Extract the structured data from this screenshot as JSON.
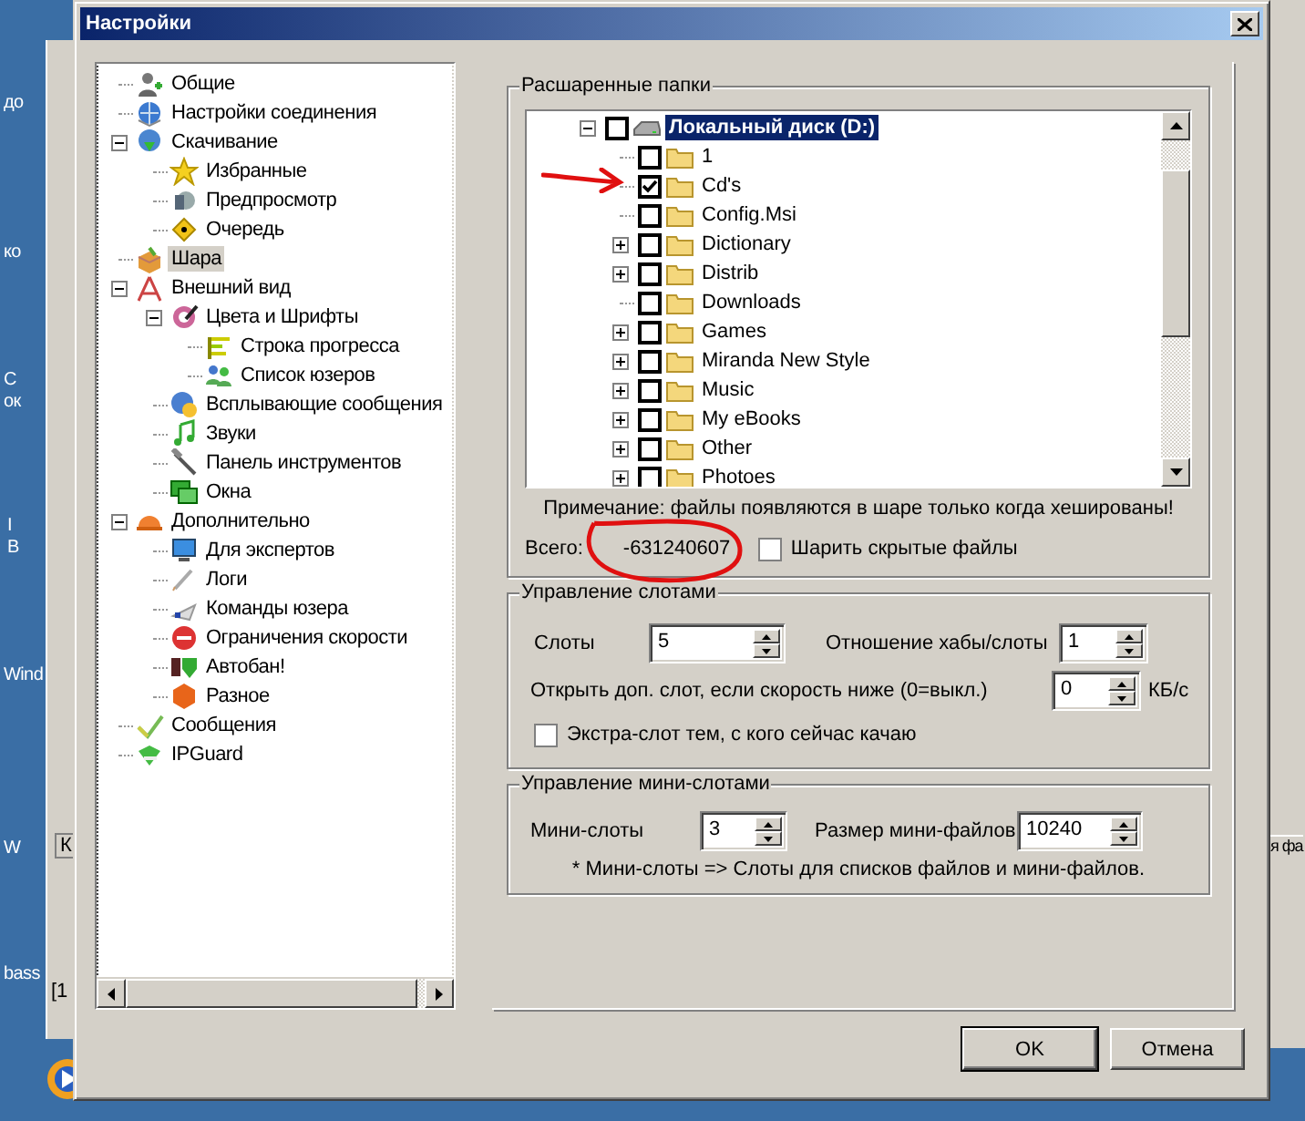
{
  "desktop": {
    "labels": [
      "до",
      "ко",
      "С",
      "ок",
      "I",
      "B",
      "Wind",
      "W",
      "bass"
    ]
  },
  "background_windows": {
    "left_texts": [
      "К",
      "[1"
    ],
    "right_text": "я фа"
  },
  "window": {
    "title": "Настройки"
  },
  "nav_tree": [
    {
      "label": "Общие",
      "selected": false
    },
    {
      "label": "Настройки соединения",
      "selected": false
    },
    {
      "label": "Скачивание",
      "selected": false,
      "expanded": true,
      "children": [
        {
          "label": "Избранные",
          "selected": false
        },
        {
          "label": "Предпросмотр",
          "selected": false
        },
        {
          "label": "Очередь",
          "selected": false
        }
      ]
    },
    {
      "label": "Шара",
      "selected": true
    },
    {
      "label": "Внешний вид",
      "selected": false,
      "expanded": true,
      "children": [
        {
          "label": "Цвета и Шрифты",
          "selected": false,
          "expanded": true,
          "children": [
            {
              "label": "Строка прогресса",
              "selected": false
            },
            {
              "label": "Список юзеров",
              "selected": false
            }
          ]
        },
        {
          "label": "Всплывающие сообщения",
          "selected": false
        },
        {
          "label": "Звуки",
          "selected": false
        },
        {
          "label": "Панель инструментов",
          "selected": false
        },
        {
          "label": "Окна",
          "selected": false
        }
      ]
    },
    {
      "label": "Дополнительно",
      "selected": false,
      "expanded": true,
      "children": [
        {
          "label": "Для экспертов",
          "selected": false
        },
        {
          "label": "Логи",
          "selected": false
        },
        {
          "label": "Команды юзера",
          "selected": false
        },
        {
          "label": "Ограничения скорости",
          "selected": false
        },
        {
          "label": "Автобан!",
          "selected": false
        },
        {
          "label": "Разное",
          "selected": false
        }
      ]
    },
    {
      "label": "Сообщения",
      "selected": false
    },
    {
      "label": "IPGuard",
      "selected": false
    }
  ],
  "shared_folders": {
    "title": "Расшаренные папки",
    "root": {
      "label": "Локальный диск (D:)",
      "checked": false,
      "selected": true,
      "expanded": true
    },
    "folders": [
      {
        "label": "1",
        "checked": false,
        "expandable": false
      },
      {
        "label": "Cd's",
        "checked": true,
        "expandable": false
      },
      {
        "label": "Config.Msi",
        "checked": false,
        "expandable": false
      },
      {
        "label": "Dictionary",
        "checked": false,
        "expandable": true
      },
      {
        "label": "Distrib",
        "checked": false,
        "expandable": true
      },
      {
        "label": "Downloads",
        "checked": false,
        "expandable": false
      },
      {
        "label": "Games",
        "checked": false,
        "expandable": true
      },
      {
        "label": "Miranda New Style",
        "checked": false,
        "expandable": true
      },
      {
        "label": "Music",
        "checked": false,
        "expandable": true
      },
      {
        "label": "My eBooks",
        "checked": false,
        "expandable": true
      },
      {
        "label": "Other",
        "checked": false,
        "expandable": true
      },
      {
        "label": "Photoes",
        "checked": false,
        "expandable": true
      }
    ],
    "note": "Примечание: файлы появляются в шаре только когда хешированы!",
    "total_label": "Всего:",
    "total_value": "-631240607",
    "share_hidden": {
      "label": "Шарить скрытые файлы",
      "checked": false
    }
  },
  "slots": {
    "title": "Управление слотами",
    "slots": {
      "label": "Слоты",
      "value": "5"
    },
    "ratio": {
      "label": "Отношение хабы/слоты",
      "value": "1"
    },
    "extra_speed": {
      "label": "Открыть доп. слот, если скорость ниже (0=выкл.)",
      "value": "0",
      "unit": "КБ/с"
    },
    "extra_slot": {
      "label": "Экстра-слот тем, с кого сейчас качаю",
      "checked": false
    }
  },
  "mini_slots": {
    "title": "Управление мини-слотами",
    "mini_slots": {
      "label": "Мини-слоты",
      "value": "3"
    },
    "size": {
      "label": "Размер мини-файлов",
      "value": "10240"
    },
    "footnote": "* Мини-слоты => Слоты для списков файлов и мини-файлов."
  },
  "buttons": [
    {
      "label": "OK",
      "default": true
    },
    {
      "label": "Отмена",
      "default": false
    }
  ]
}
